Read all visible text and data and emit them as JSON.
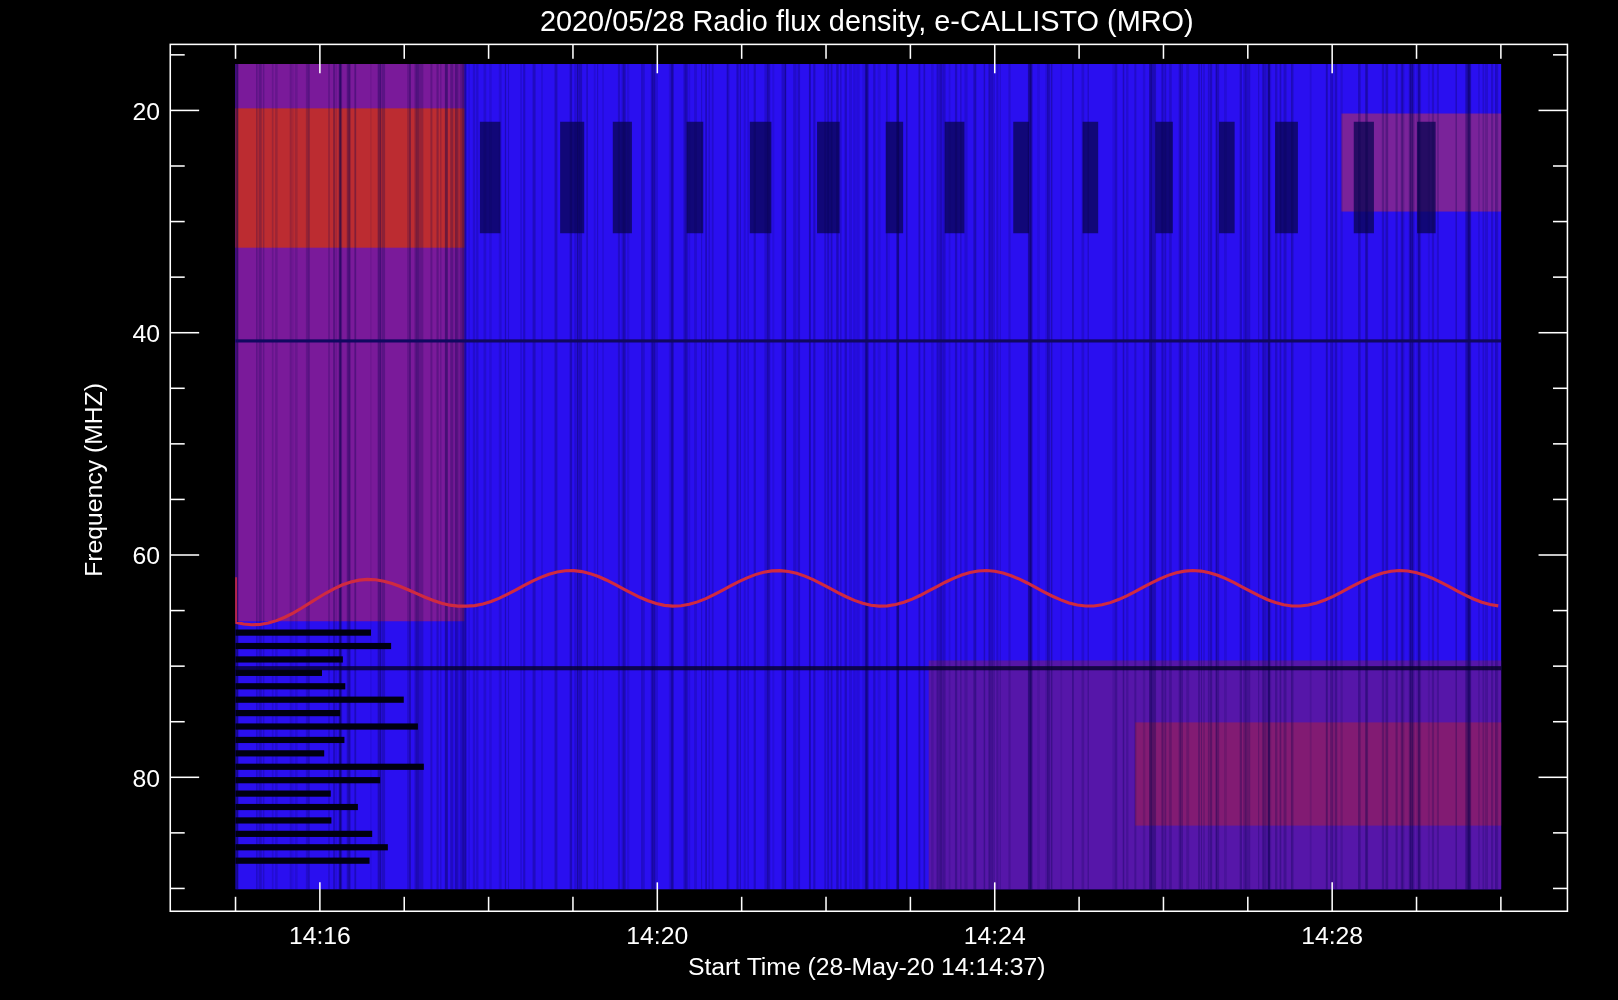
{
  "title": "2020/05/28  Radio flux density, e-CALLISTO (MRO)",
  "plot": {
    "ylabel": "Frequency (MHZ)",
    "xlabel": "Start Time (28-May-20 14:14:37)",
    "y_tick_labels": [
      "20",
      "40",
      "60",
      "80"
    ],
    "x_tick_labels": [
      "14:16",
      "14:20",
      "14:24",
      "14:28"
    ]
  }
}
